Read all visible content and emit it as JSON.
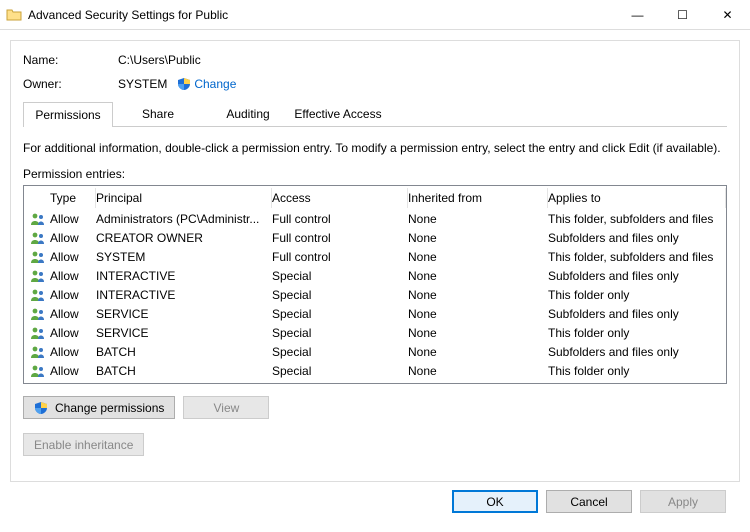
{
  "window": {
    "title": "Advanced Security Settings for Public"
  },
  "header": {
    "name_label": "Name:",
    "name_value": "C:\\Users\\Public",
    "owner_label": "Owner:",
    "owner_value": "SYSTEM",
    "change_link": "Change"
  },
  "tabs": {
    "permissions": "Permissions",
    "share": "Share",
    "auditing": "Auditing",
    "effective": "Effective Access"
  },
  "info_text": "For additional information, double-click a permission entry. To modify a permission entry, select the entry and click Edit (if available).",
  "entries_label": "Permission entries:",
  "columns": {
    "type": "Type",
    "principal": "Principal",
    "access": "Access",
    "inherited": "Inherited from",
    "applies": "Applies to"
  },
  "entries": [
    {
      "type": "Allow",
      "principal": "Administrators (PC\\Administr...",
      "access": "Full control",
      "inherited": "None",
      "applies": "This folder, subfolders and files"
    },
    {
      "type": "Allow",
      "principal": "CREATOR OWNER",
      "access": "Full control",
      "inherited": "None",
      "applies": "Subfolders and files only"
    },
    {
      "type": "Allow",
      "principal": "SYSTEM",
      "access": "Full control",
      "inherited": "None",
      "applies": "This folder, subfolders and files"
    },
    {
      "type": "Allow",
      "principal": "INTERACTIVE",
      "access": "Special",
      "inherited": "None",
      "applies": "Subfolders and files only"
    },
    {
      "type": "Allow",
      "principal": "INTERACTIVE",
      "access": "Special",
      "inherited": "None",
      "applies": "This folder only"
    },
    {
      "type": "Allow",
      "principal": "SERVICE",
      "access": "Special",
      "inherited": "None",
      "applies": "Subfolders and files only"
    },
    {
      "type": "Allow",
      "principal": "SERVICE",
      "access": "Special",
      "inherited": "None",
      "applies": "This folder only"
    },
    {
      "type": "Allow",
      "principal": "BATCH",
      "access": "Special",
      "inherited": "None",
      "applies": "Subfolders and files only"
    },
    {
      "type": "Allow",
      "principal": "BATCH",
      "access": "Special",
      "inherited": "None",
      "applies": "This folder only"
    }
  ],
  "buttons": {
    "change_perms": "Change permissions",
    "view": "View",
    "enable_inherit": "Enable inheritance",
    "ok": "OK",
    "cancel": "Cancel",
    "apply": "Apply"
  }
}
